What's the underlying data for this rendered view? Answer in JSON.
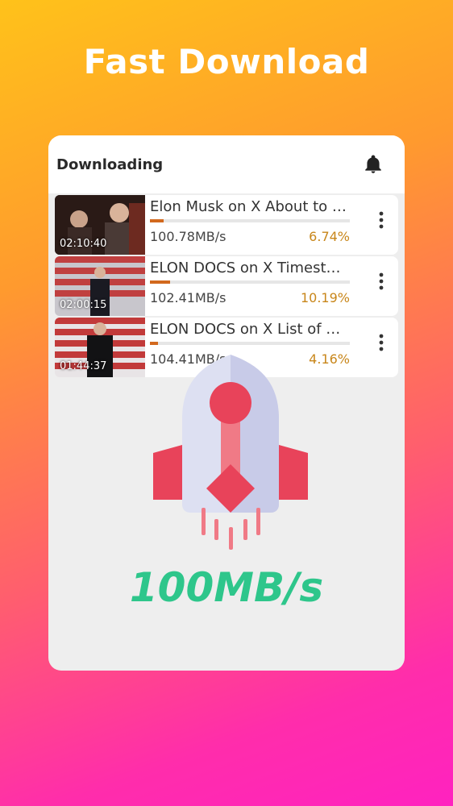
{
  "headline": "Fast Download",
  "card": {
    "title": "Downloading",
    "bell_icon": "bell-icon"
  },
  "downloads": [
    {
      "duration": "02:10:40",
      "title": "Elon Musk on X About to …",
      "speed": "100.78MB/s",
      "percent": "6.74%",
      "progress": 0.0674
    },
    {
      "duration": "02:00:15",
      "title": "ELON DOCS on X Timest…",
      "speed": "102.41MB/s",
      "percent": "10.19%",
      "progress": 0.1019
    },
    {
      "duration": "01:44:37",
      "title": "ELON DOCS on X List of …",
      "speed": "104.41MB/s",
      "percent": "4.16%",
      "progress": 0.0416
    }
  ],
  "banner": {
    "rocket_icon": "rocket-icon",
    "speed": "100MB/s"
  },
  "colors": {
    "progress": "#d2691e",
    "percent": "#c8861a",
    "speed_text": "#2ec68b"
  }
}
